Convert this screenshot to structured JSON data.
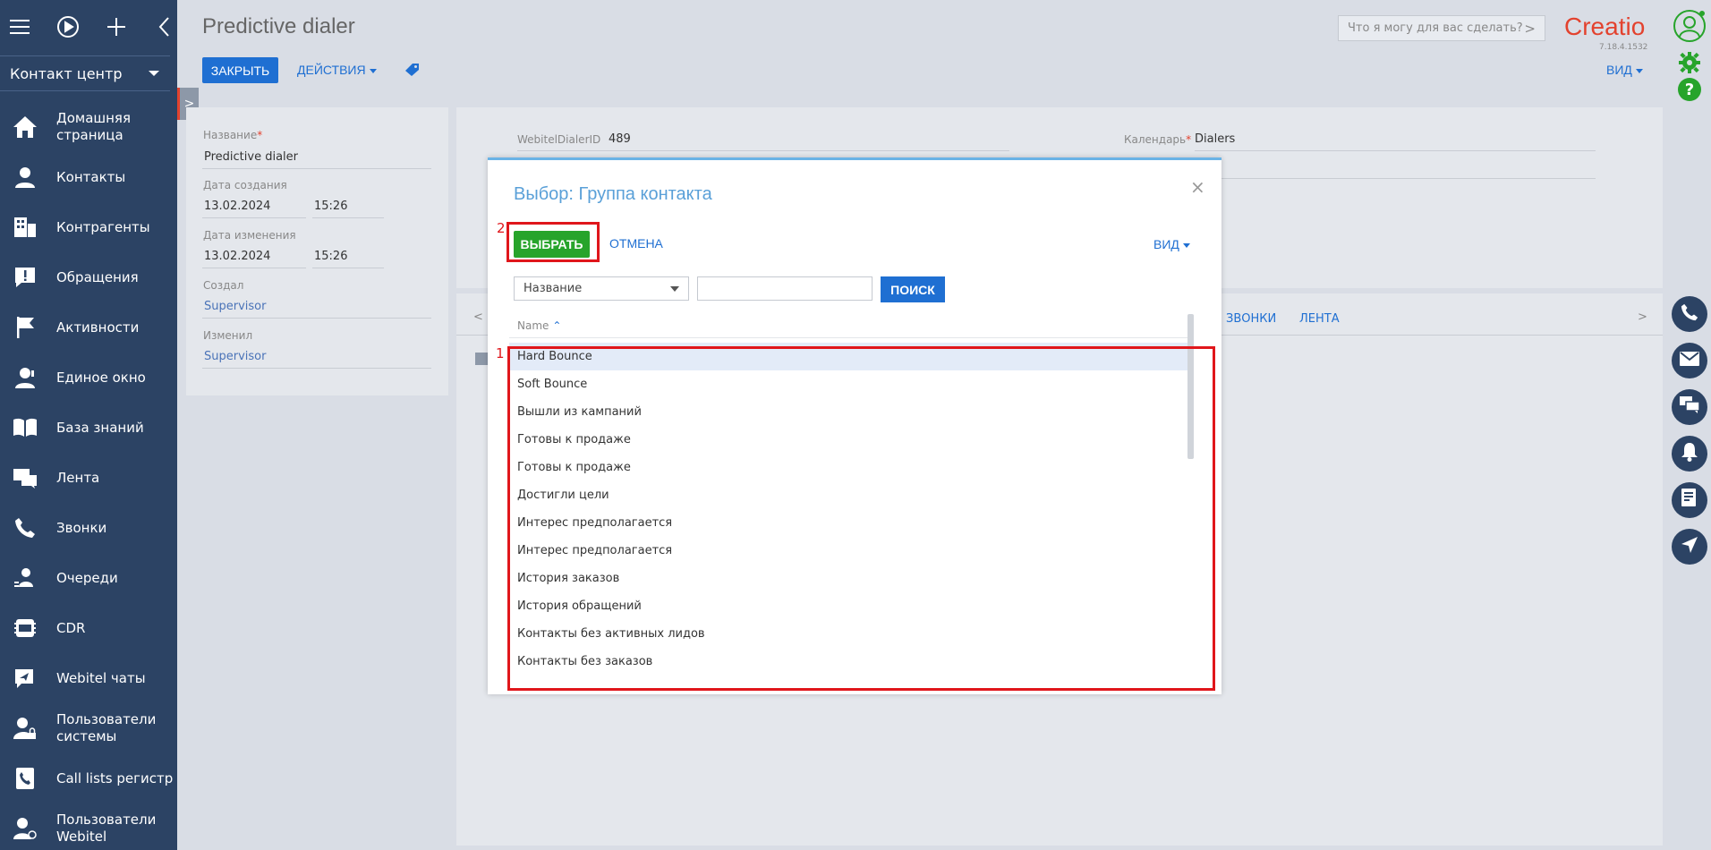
{
  "sidebar": {
    "workspace": "Контакт центр",
    "items": [
      {
        "label": "Домашняя страница",
        "icon": "home-icon"
      },
      {
        "label": "Контакты",
        "icon": "person-icon"
      },
      {
        "label": "Контрагенты",
        "icon": "building-icon"
      },
      {
        "label": "Обращения",
        "icon": "alert-chat-icon"
      },
      {
        "label": "Активности",
        "icon": "flag-icon"
      },
      {
        "label": "Единое окно",
        "icon": "agent-icon"
      },
      {
        "label": "База знаний",
        "icon": "book-icon"
      },
      {
        "label": "Лента",
        "icon": "feed-icon"
      },
      {
        "label": "Звонки",
        "icon": "phone-icon"
      },
      {
        "label": "Очереди",
        "icon": "queue-icon"
      },
      {
        "label": "CDR",
        "icon": "cdr-icon"
      },
      {
        "label": "Webitel чаты",
        "icon": "chat-send-icon"
      },
      {
        "label": "Пользователи системы",
        "icon": "user-lock-icon"
      },
      {
        "label": "Call lists регистр",
        "icon": "call-list-icon"
      },
      {
        "label": "Пользователи Webitel",
        "icon": "user-webitel-icon"
      }
    ]
  },
  "header": {
    "title": "Predictive dialer",
    "close_label": "ЗАКРЫТЬ",
    "actions_label": "ДЕЙСТВИЯ",
    "search_placeholder": "Что я могу для вас сделать?",
    "logo": "Creatio",
    "version": "7.18.4.1532",
    "view_label": "ВИД"
  },
  "info": {
    "name_label": "Название",
    "name_value": "Predictive dialer",
    "created_label": "Дата создания",
    "created_date": "13.02.2024",
    "created_time": "15:26",
    "modified_label": "Дата изменения",
    "modified_date": "13.02.2024",
    "modified_time": "15:26",
    "creator_label": "Создал",
    "creator_value": "Supervisor",
    "modifier_label": "Изменил",
    "modifier_value": "Supervisor"
  },
  "panel": {
    "dialer_id_label": "WebitelDialerID",
    "dialer_id_value": "489",
    "calendar_label": "Календарь",
    "calendar_value": "Dialers",
    "tab_calls": "ЗВОНКИ",
    "tab_feed": "ЛЕНТА"
  },
  "modal": {
    "title": "Выбор: Группа контакта",
    "select_label": "ВЫБРАТЬ",
    "cancel_label": "ОТМЕНА",
    "view_label": "ВИД",
    "filter_field": "Название",
    "search_label": "ПОИСК",
    "column_header": "Name",
    "rows": [
      "Hard Bounce",
      "Soft Bounce",
      "Вышли из кампаний",
      "Готовы к продаже",
      "Готовы к продаже",
      "Достигли цели",
      "Интерес предполагается",
      "Интерес предполагается",
      "История заказов",
      "История обращений",
      "Контакты без активных лидов",
      "Контакты без заказов"
    ]
  },
  "annotations": {
    "label1": "1",
    "label2": "2",
    "color": "#e0161b"
  },
  "colors": {
    "sidebar": "#2c4364",
    "primary": "#1f6fd2",
    "select_button": "#27a42b",
    "logo": "#e3422e"
  }
}
